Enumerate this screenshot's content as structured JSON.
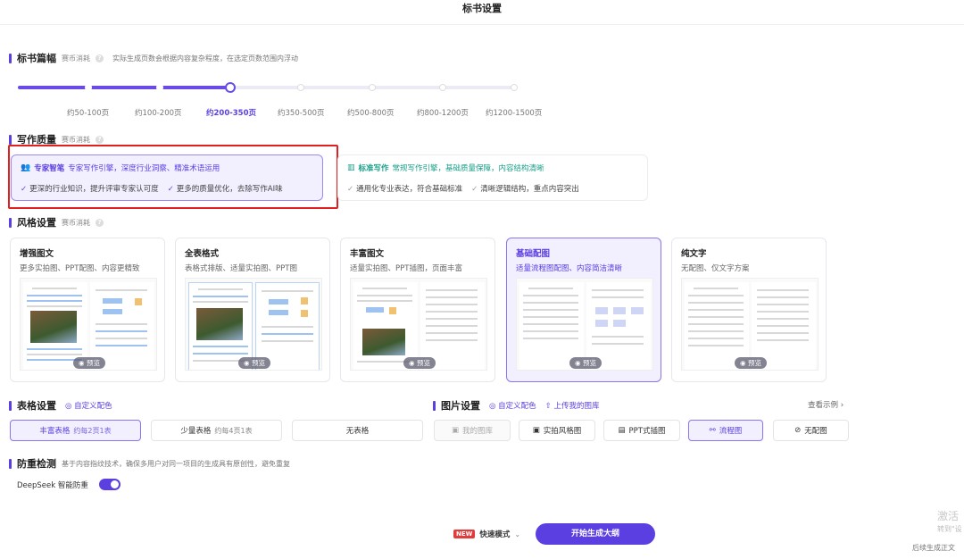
{
  "header": {
    "title": "标书设置"
  },
  "length": {
    "title": "标书篇幅",
    "cost": "赛币消耗",
    "desc": "实际生成页数会根据内容复杂程度，在选定页数范围内浮动",
    "options": [
      "约50-100页",
      "约100-200页",
      "约200-350页",
      "约350-500页",
      "约500-800页",
      "约800-1200页",
      "约1200-1500页"
    ],
    "selected_index": 2
  },
  "quality": {
    "title": "写作质量",
    "cost": "赛币消耗",
    "expert": {
      "name": "专家智笔",
      "desc": "专家写作引擎，深度行业洞察、精准术语运用",
      "point1": "更深的行业知识，提升评审专家认可度",
      "point2": "更多的质量优化，去除写作AI味"
    },
    "standard": {
      "name": "标准写作",
      "desc": "常规写作引擎，基础质量保障，内容结构清晰",
      "point1": "通用化专业表达，符合基础标准",
      "point2": "清晰逻辑结构，重点内容突出"
    }
  },
  "style": {
    "title": "风格设置",
    "cost": "赛币消耗",
    "preview_label": "预览",
    "cards": [
      {
        "title": "增强图文",
        "desc": "更多实拍图、PPT配图、内容更精致"
      },
      {
        "title": "全表格式",
        "desc": "表格式排版、适量实拍图、PPT图"
      },
      {
        "title": "丰富图文",
        "desc": "适量实拍图、PPT插图，页面丰富"
      },
      {
        "title": "基础配图",
        "desc": "适量流程图配图、内容简洁清晰"
      },
      {
        "title": "纯文字",
        "desc": "无配图、仅文字方案"
      }
    ],
    "selected_index": 3
  },
  "table": {
    "title": "表格设置",
    "custom_color": "自定义配色",
    "options": [
      {
        "label": "丰富表格",
        "sub": "约每2页1表"
      },
      {
        "label": "少量表格",
        "sub": "约每4页1表"
      },
      {
        "label": "无表格",
        "sub": ""
      }
    ],
    "selected_index": 0
  },
  "image": {
    "title": "图片设置",
    "custom_color": "自定义配色",
    "upload": "上传我的图库",
    "example": "查看示例",
    "options": [
      "我的图库",
      "实拍风格图",
      "PPT式插图",
      "流程图",
      "无配图"
    ],
    "selected_index": 3
  },
  "dup": {
    "title": "防重检测",
    "desc": "基于内容指纹技术，确保多用户对同一项目的生成具有原创性，避免重复",
    "toggle_label": "DeepSeek 智能防重"
  },
  "footer": {
    "badge": "NEW",
    "mode": "快速模式",
    "generate": "开始生成大纲"
  },
  "watermark": {
    "line1": "激活",
    "line2": "转到\"设",
    "line3": "后续生成正文"
  },
  "colors": {
    "accent": "#5b3fe0",
    "highlight": "#e02020"
  }
}
